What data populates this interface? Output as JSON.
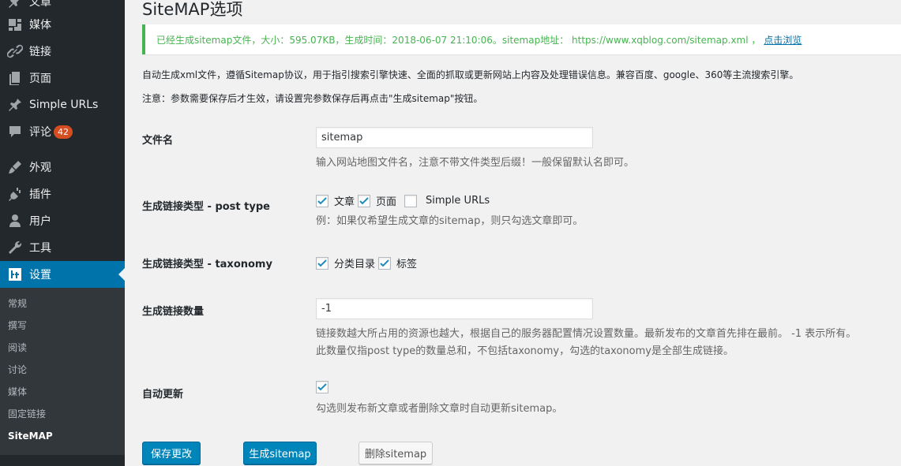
{
  "sidebar": {
    "items": [
      {
        "label": "文章",
        "icon": "pin-icon"
      },
      {
        "label": "媒体",
        "icon": "media-icon"
      },
      {
        "label": "链接",
        "icon": "link-icon"
      },
      {
        "label": "页面",
        "icon": "page-icon"
      },
      {
        "label": "Simple URLs",
        "icon": "pin-icon"
      },
      {
        "label": "评论",
        "icon": "comment-icon",
        "badge": "42"
      },
      {
        "label": "外观",
        "icon": "brush-icon"
      },
      {
        "label": "插件",
        "icon": "plugin-icon"
      },
      {
        "label": "用户",
        "icon": "user-icon"
      },
      {
        "label": "工具",
        "icon": "wrench-icon"
      },
      {
        "label": "设置",
        "icon": "settings-icon"
      }
    ],
    "submenu": [
      "常规",
      "撰写",
      "阅读",
      "讨论",
      "媒体",
      "固定链接",
      "SiteMAP"
    ]
  },
  "main": {
    "title": "SiteMAP选项",
    "notice": {
      "text": "已经生成sitemap文件，大小：595.07KB，生成时间：2018-06-07 21:10:06。sitemap地址： https://www.xqblog.com/sitemap.xml ，",
      "link": "点击浏览"
    },
    "desc1": "自动生成xml文件，遵循Sitemap协议，用于指引搜索引擎快速、全面的抓取或更新网站上内容及处理错误信息。兼容百度、google、360等主流搜索引擎。",
    "desc2": "注意：参数需要保存后才生效，请设置完参数保存后再点击\"生成sitemap\"按钮。",
    "filename": {
      "label": "文件名",
      "value": "sitemap",
      "help": "输入网站地图文件名，注意不带文件类型后缀！一般保留默认名即可。"
    },
    "post_type": {
      "label": "生成链接类型 - post type",
      "options": [
        {
          "label": "文章",
          "checked": true
        },
        {
          "label": "页面",
          "checked": true
        },
        {
          "label": "Simple URLs",
          "checked": false
        }
      ],
      "help": "例：如果仅希望生成文章的sitemap，则只勾选文章即可。"
    },
    "taxonomy": {
      "label": "生成链接类型 - taxonomy",
      "options": [
        {
          "label": "分类目录",
          "checked": true
        },
        {
          "label": "标签",
          "checked": true
        }
      ]
    },
    "count": {
      "label": "生成链接数量",
      "value": "-1",
      "help1": "链接数越大所占用的资源也越大，根据自己的服务器配置情况设置数量。最新发布的文章首先排在最前。 -1 表示所有。",
      "help2": "此数量仅指post type的数量总和，不包括taxonomy，勾选的taxonomy是全部生成链接。"
    },
    "auto_update": {
      "label": "自动更新",
      "checked": true,
      "help": "勾选则发布新文章或者删除文章时自动更新sitemap。"
    },
    "buttons": {
      "save": "保存更改",
      "generate": "生成sitemap",
      "delete": "删除sitemap"
    }
  },
  "colors": {
    "sidebar_bg": "#23282d",
    "accent": "#0073aa",
    "notice_green": "#46b450",
    "badge": "#d54e21"
  }
}
